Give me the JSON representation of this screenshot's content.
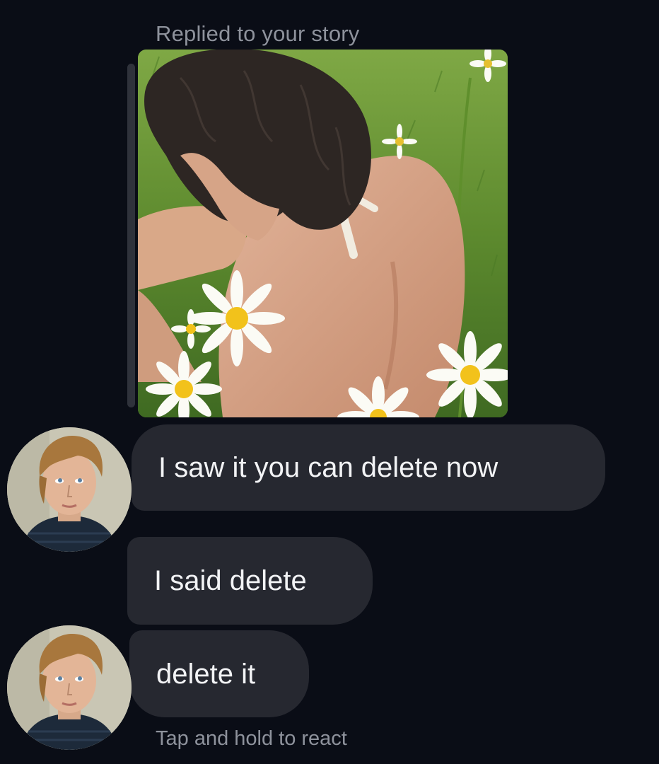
{
  "reply_label": "Replied to your story",
  "story": {
    "icon": "story-photo-thumbnail"
  },
  "messages": [
    {
      "text": "I saw it you can delete now"
    },
    {
      "text": "I said delete"
    },
    {
      "text": "delete it"
    }
  ],
  "hint": "Tap and hold to react",
  "colors": {
    "background": "#0a0d16",
    "bubble": "#262830",
    "bubble_text": "#f2f3f5",
    "muted_text": "#8e929c"
  }
}
